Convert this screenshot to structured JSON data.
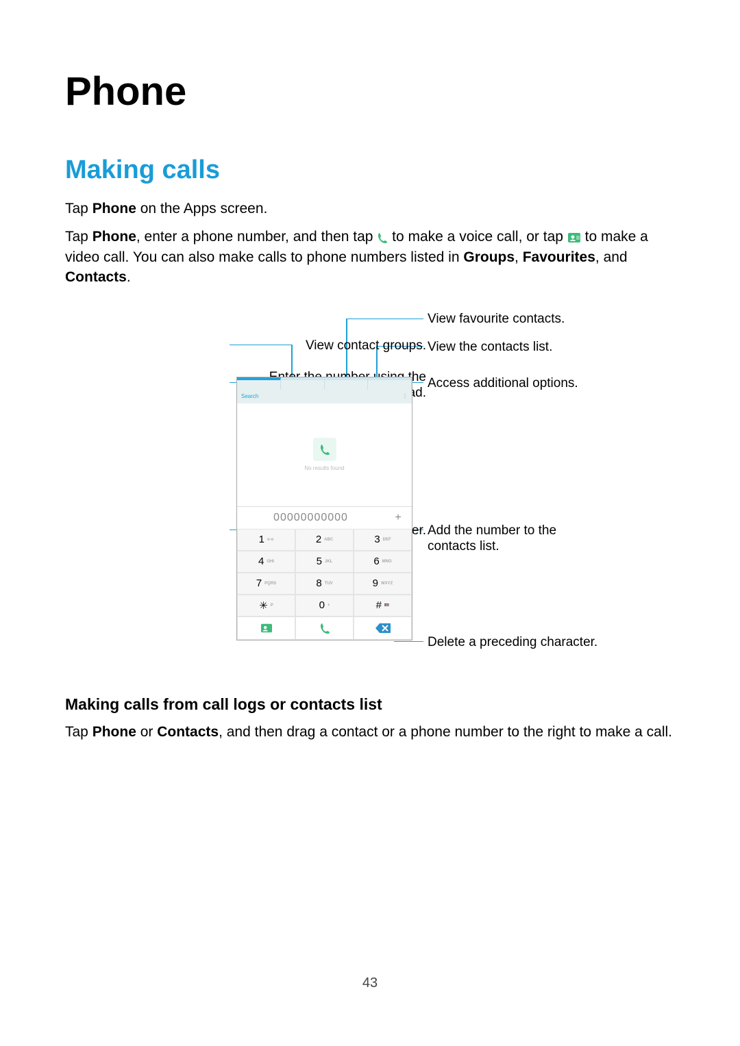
{
  "page_title": "Phone",
  "page_number": "43",
  "section_h2": "Making calls",
  "p1_before_bold": "Tap ",
  "p1_bold1": "Phone",
  "p1_after_bold": " on the Apps screen.",
  "p2_a": "Tap ",
  "p2_bold1": "Phone",
  "p2_b": ", enter a phone number, and then tap ",
  "p2_c": " to make a voice call, or tap ",
  "p2_d": " to make a video call. You can also make calls to phone numbers listed in ",
  "p2_bold2": "Groups",
  "p2_e": ", ",
  "p2_bold3": "Favourites",
  "p2_f": ", and ",
  "p2_bold4": "Contacts",
  "p2_g": ".",
  "labels": {
    "view_fav": "View favourite contacts.",
    "view_groups": "View contact groups.",
    "enter_keypad_l1": "Enter the number using the",
    "enter_keypad_l2": "keypad.",
    "view_contacts": "View the contacts list.",
    "access_options": "Access additional options.",
    "preview_num": "Preview the phone number.",
    "add_l1": "Add the number to the",
    "add_l2": "contacts list.",
    "delete_char": "Delete a preceding character."
  },
  "phone": {
    "number_preview": "00000000000",
    "plus": "+",
    "search_text": "Search",
    "no_results": "No results found",
    "keys": {
      "k1": "1",
      "s1": "o-o",
      "k2": "2",
      "s2": "ABC",
      "k3": "3",
      "s3": "DEF",
      "k4": "4",
      "s4": "GHI",
      "k5": "5",
      "s5": "JKL",
      "k6": "6",
      "s6": "MNO",
      "k7": "7",
      "s7": "PQRS",
      "k8": "8",
      "s8": "TUV",
      "k9": "9",
      "s9": "WXYZ",
      "kstar": "✳",
      "sstar": "P",
      "k0": "0",
      "s0": "+",
      "khash": "#",
      "shash": ""
    }
  },
  "h3": "Making calls from call logs or contacts list",
  "p3_a": "Tap ",
  "p3_b1": "Phone",
  "p3_b": " or ",
  "p3_b2": "Contacts",
  "p3_c": ", and then drag a contact or a phone number to the right to make a call."
}
